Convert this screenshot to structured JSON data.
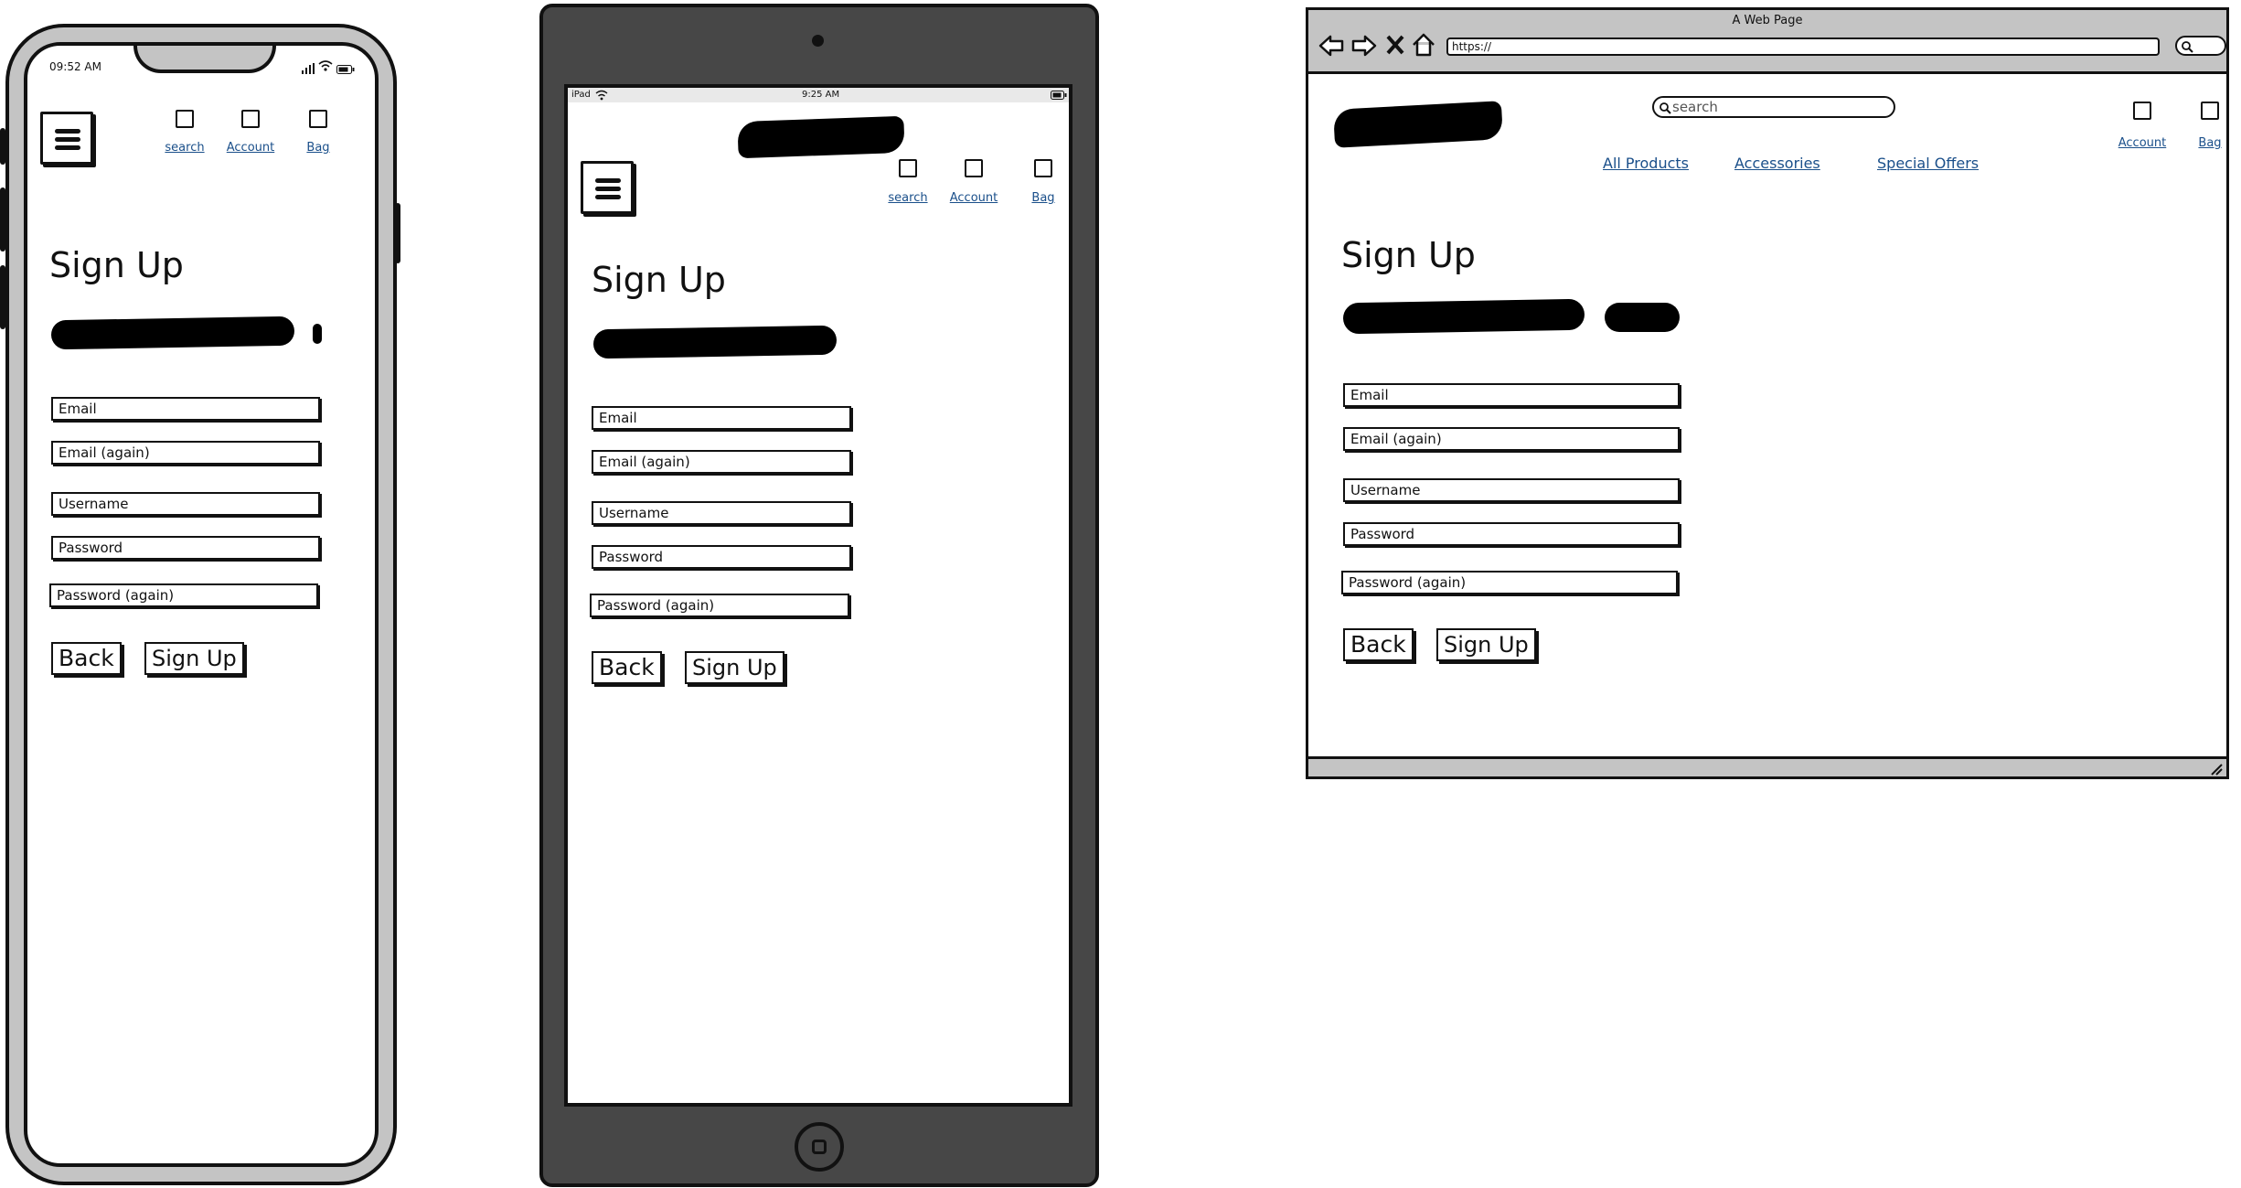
{
  "phone": {
    "time": "09:52 AM",
    "top_links": [
      "search",
      "Account",
      "Bag"
    ],
    "title": "Sign Up",
    "fields": [
      "Email",
      "Email (again)",
      "Username",
      "Password",
      "Password (again)"
    ],
    "buttons": {
      "back": "Back",
      "signup": "Sign Up"
    }
  },
  "tablet": {
    "device_label": "iPad",
    "time": "9:25 AM",
    "top_links": [
      "search",
      "Account",
      "Bag"
    ],
    "title": "Sign Up",
    "fields": [
      "Email",
      "Email (again)",
      "Username",
      "Password",
      "Password (again)"
    ],
    "buttons": {
      "back": "Back",
      "signup": "Sign Up"
    }
  },
  "browser": {
    "window_title": "A Web Page",
    "url": "https://",
    "search_placeholder": "search",
    "top_links": [
      "Account",
      "Bag"
    ],
    "nav_links": [
      "All Products",
      "Accessories",
      "Special Offers"
    ],
    "title": "Sign Up",
    "fields": [
      "Email",
      "Email (again)",
      "Username",
      "Password",
      "Password (again)"
    ],
    "buttons": {
      "back": "Back",
      "signup": "Sign Up"
    }
  }
}
